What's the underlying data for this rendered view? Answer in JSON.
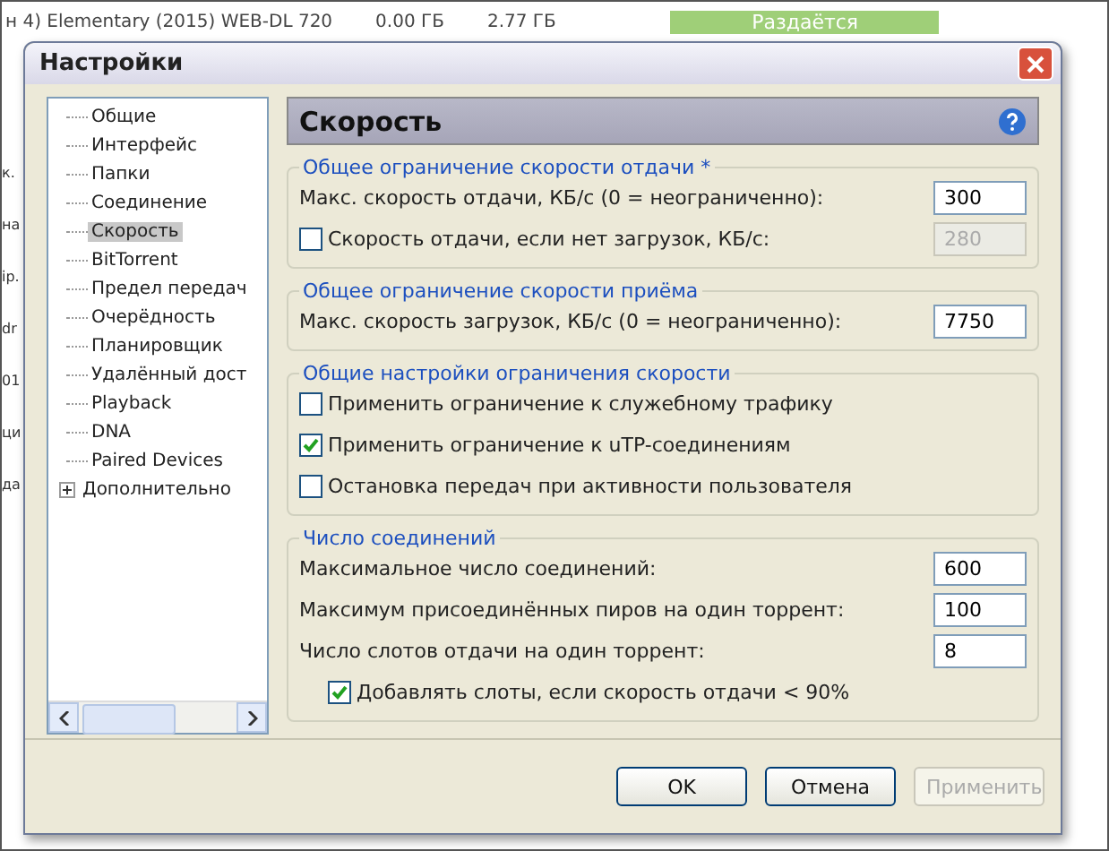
{
  "background": {
    "top_row": [
      "н 4) Elementary (2015) WEB-DL 720",
      "0.00 ГБ",
      "2.77 ГБ"
    ],
    "status": "Раздаётся",
    "left_fragments": [
      "к.",
      "на",
      "ip.",
      "dr",
      "01",
      "ци",
      "да"
    ]
  },
  "window": {
    "title": "Настройки"
  },
  "sidebar": {
    "items": [
      {
        "label": "Общие",
        "selected": false
      },
      {
        "label": "Интерфейс",
        "selected": false
      },
      {
        "label": "Папки",
        "selected": false
      },
      {
        "label": "Соединение",
        "selected": false
      },
      {
        "label": "Скорость",
        "selected": true
      },
      {
        "label": "BitTorrent",
        "selected": false
      },
      {
        "label": "Предел передач",
        "selected": false
      },
      {
        "label": "Очерёдность",
        "selected": false
      },
      {
        "label": "Планировщик",
        "selected": false
      },
      {
        "label": "Удалённый дост",
        "selected": false
      },
      {
        "label": "Playback",
        "selected": false
      },
      {
        "label": "DNA",
        "selected": false
      },
      {
        "label": "Paired Devices",
        "selected": false
      },
      {
        "label": "Дополнительно",
        "selected": false,
        "expandable": true
      }
    ]
  },
  "panel": {
    "title": "Скорость",
    "groups": [
      {
        "title": "Общее ограничение скорости отдачи *",
        "rows": [
          {
            "kind": "field",
            "label": "Макс. скорость отдачи, КБ/с (0 = неограниченно):",
            "value": "300",
            "disabled": false
          },
          {
            "kind": "checkfield",
            "label": "Скорость отдачи, если нет загрузок, КБ/с:",
            "checked": false,
            "value": "280",
            "disabled": true
          }
        ]
      },
      {
        "title": "Общее ограничение скорости приёма",
        "rows": [
          {
            "kind": "field",
            "label": "Макс. скорость загрузок, КБ/с (0 = неограниченно):",
            "value": "7750",
            "disabled": false
          }
        ]
      },
      {
        "title": "Общие настройки ограничения скорости",
        "rows": [
          {
            "kind": "check",
            "label": "Применить ограничение к служебному трафику",
            "checked": false
          },
          {
            "kind": "check",
            "label": "Применить ограничение к uTP-соединениям",
            "checked": true
          },
          {
            "kind": "check",
            "label": "Остановка передач при активности пользователя",
            "checked": false
          }
        ]
      },
      {
        "title": "Число соединений",
        "rows": [
          {
            "kind": "field",
            "label": "Максимальное число соединений:",
            "value": "600",
            "disabled": false
          },
          {
            "kind": "field",
            "label": "Максимум присоединённых пиров на один торрент:",
            "value": "100",
            "disabled": false
          },
          {
            "kind": "field",
            "label": "Число слотов отдачи на один торрент:",
            "value": "8",
            "disabled": false
          },
          {
            "kind": "subcheck",
            "label": "Добавлять слоты, если скорость отдачи < 90%",
            "checked": true
          }
        ]
      }
    ]
  },
  "buttons": [
    {
      "label": "OK",
      "disabled": false
    },
    {
      "label": "Отмена",
      "disabled": false
    },
    {
      "label": "Применить",
      "disabled": true
    }
  ]
}
